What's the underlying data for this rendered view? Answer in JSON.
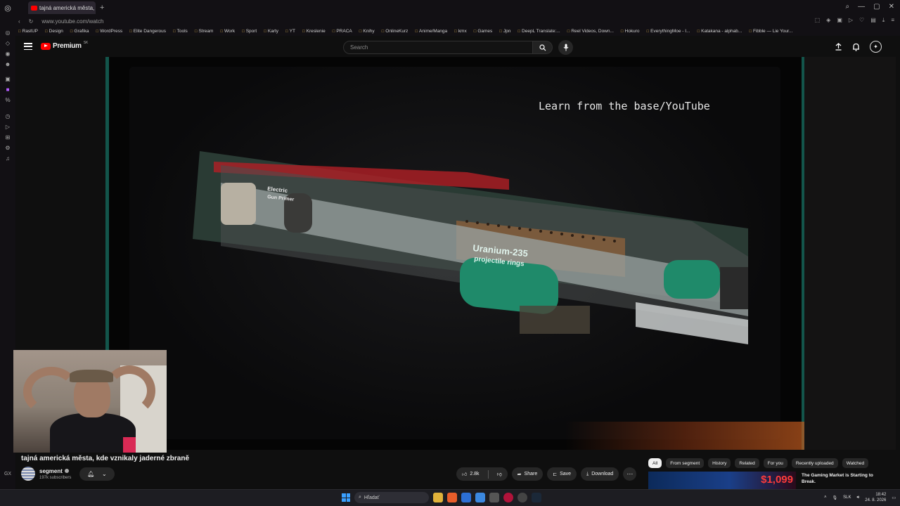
{
  "browser": {
    "tab_title": "tajná americká města, k",
    "address": "www.youtube.com/watch",
    "bookmarks": [
      "RastUP",
      "Design",
      "Grafika",
      "WordPress",
      "Elite Dangerous",
      "Tools",
      "Stream",
      "Work",
      "Sport",
      "Karty",
      "YT",
      "Kreslenie",
      "PRACA",
      "Knihy",
      "OnlineKurz",
      "Anime/Manga",
      "kmx",
      "Games",
      "Jpn",
      "DeepL Translate:...",
      "Reel Videos, Down...",
      "Hokuro",
      "EverythingMoe - I...",
      "Katakana - alphab...",
      "Fibble — Lie Your..."
    ],
    "sidebar_bottom": "GX"
  },
  "youtube": {
    "logo_text": "Premium",
    "country_code": "SK",
    "search_placeholder": "Search"
  },
  "video": {
    "watermark": "Learn from the base/YouTube",
    "title": "tajná americká města, kde vznikaly jaderné zbraně"
  },
  "channel": {
    "name": "segment",
    "subscribers": "197k subscribers"
  },
  "actions": {
    "likes": "2.8k",
    "share": "Share",
    "save": "Save",
    "download": "Download"
  },
  "chips": [
    "All",
    "From segment",
    "History",
    "Related",
    "For you",
    "Recently uploaded",
    "Watched"
  ],
  "ad": {
    "price": "$1,099",
    "title": "The Gaming Market is Starting to Break."
  },
  "taskbar": {
    "search": "Hľadať",
    "lang": "SLK",
    "time": "18:42",
    "date": "24. 8. 2026"
  }
}
